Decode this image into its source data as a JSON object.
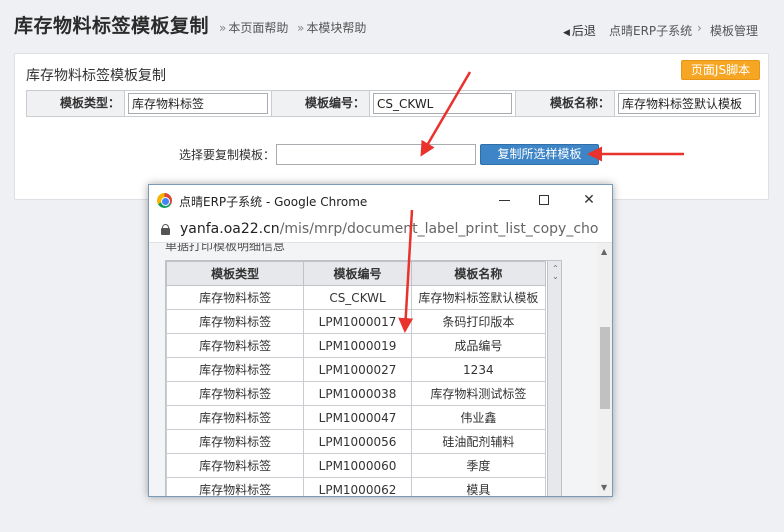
{
  "header": {
    "title": "库存物料标签模板复制",
    "help_page": "本页面帮助",
    "help_module": "本模块帮助",
    "help_arrow": "»",
    "back": "后退",
    "breadcrumb_system": "点晴ERP子系统",
    "breadcrumb_sep": "›",
    "breadcrumb_page": "模板管理"
  },
  "panel": {
    "title": "库存物料标签模板复制",
    "js_button": "页面JS脚本",
    "fields": [
      {
        "label": "模板类型：",
        "value": "库存物料标签"
      },
      {
        "label": "模板编号：",
        "value": "CS_CKWL"
      },
      {
        "label": "模板名称：",
        "value": "库存物料标签默认模板"
      }
    ],
    "select_label": "选择要复制模板：",
    "select_value": "",
    "copy_button": "复制所选样模板"
  },
  "popup": {
    "title": "点晴ERP子系统 - Google Chrome",
    "url_domain": "yanfa.oa22.cn",
    "url_path": "/mis/mrp/document_label_print_list_copy_cho...",
    "clipped_heading": "单据打印模板明细信息",
    "table": {
      "headers": [
        "模板类型",
        "模板编号",
        "模板名称"
      ],
      "rows": [
        [
          "库存物料标签",
          "CS_CKWL",
          "库存物料标签默认模板"
        ],
        [
          "库存物料标签",
          "LPM1000017",
          "条码打印版本"
        ],
        [
          "库存物料标签",
          "LPM1000019",
          "成品编号"
        ],
        [
          "库存物料标签",
          "LPM1000027",
          "1234"
        ],
        [
          "库存物料标签",
          "LPM1000038",
          "库存物料测试标签"
        ],
        [
          "库存物料标签",
          "LPM1000047",
          "伟业鑫"
        ],
        [
          "库存物料标签",
          "LPM1000056",
          "硅油配剂辅料"
        ],
        [
          "库存物料标签",
          "LPM1000060",
          "季度"
        ],
        [
          "库存物料标签",
          "LPM1000062",
          "模具"
        ]
      ]
    }
  },
  "colors": {
    "accent_blue": "#3d85c6",
    "accent_orange": "#f6a623",
    "annotation_red": "#e8322b"
  },
  "icons": [
    "back-triangle-icon",
    "chrome-logo-icon",
    "minimize-icon",
    "maximize-icon",
    "close-icon",
    "lock-icon",
    "sort-icon",
    "scroll-up-icon",
    "scroll-down-icon"
  ]
}
